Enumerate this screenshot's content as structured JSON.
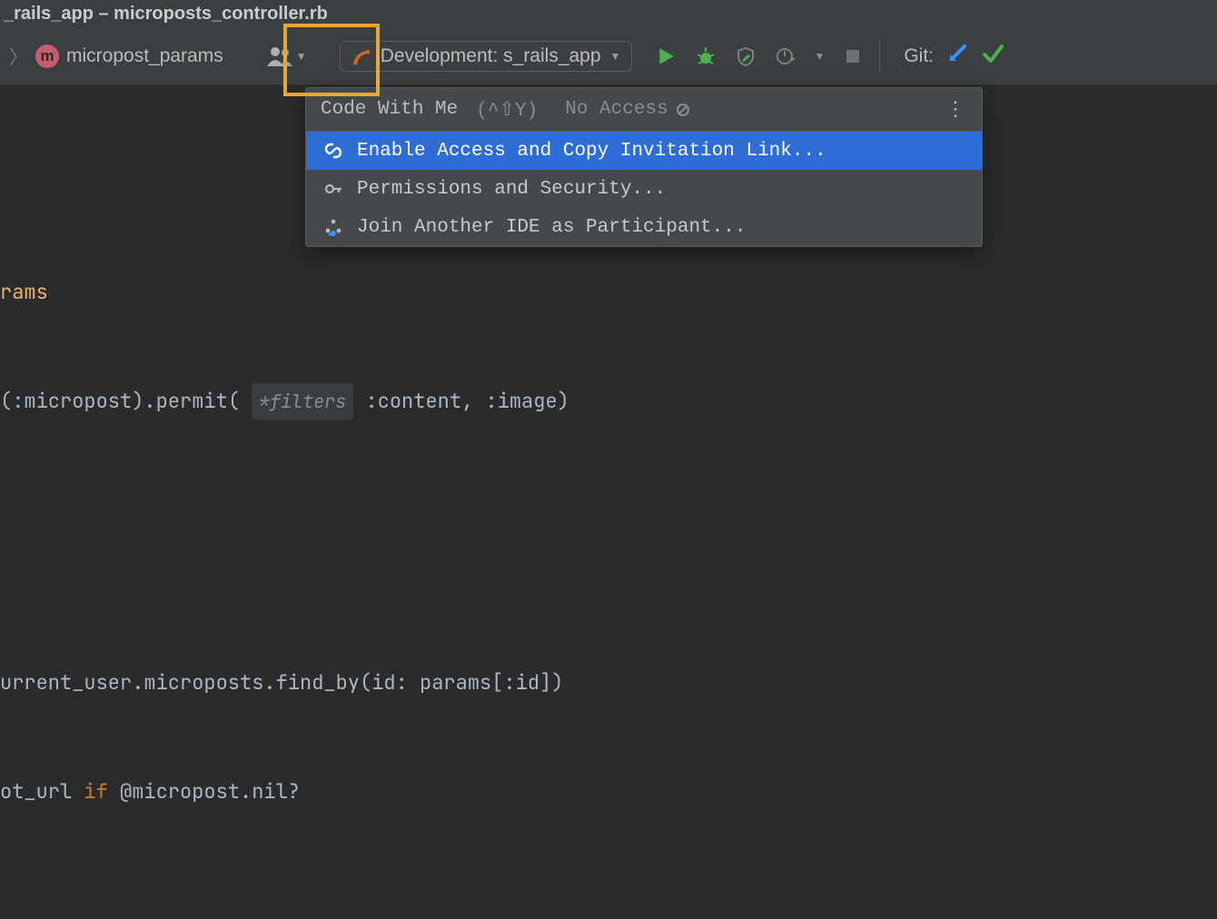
{
  "window": {
    "title": "_rails_app – microposts_controller.rb"
  },
  "breadcrumb": {
    "item": "micropost_params",
    "icon_letter": "m"
  },
  "run_config": {
    "label": "Development: s_rails_app"
  },
  "git": {
    "label": "Git:"
  },
  "panel": {
    "title": "Code With Me",
    "shortcut": "(^⇧Y)",
    "status": "No Access",
    "items": [
      {
        "label": "Enable Access and Copy Invitation Link..."
      },
      {
        "label": "Permissions and Security..."
      },
      {
        "label": "Join Another IDE as Participant..."
      }
    ]
  },
  "code": {
    "l1": "rams",
    "l2a": "(",
    "l2b": ":micropost",
    "l2c": ").permit(",
    "l2hint": "*filters",
    "l2d": ":content",
    "l2e": ", ",
    "l2f": ":image",
    "l2g": ")",
    "l3": "",
    "l4": "urrent_user.microposts.find_by(",
    "l4k": "id:",
    "l4v": " params[",
    "l4s": ":id",
    "l4e": "])",
    "l5a": "ot_url ",
    "l5b": "if",
    "l5c": " @micropost",
    "l5d": ".nil?"
  }
}
